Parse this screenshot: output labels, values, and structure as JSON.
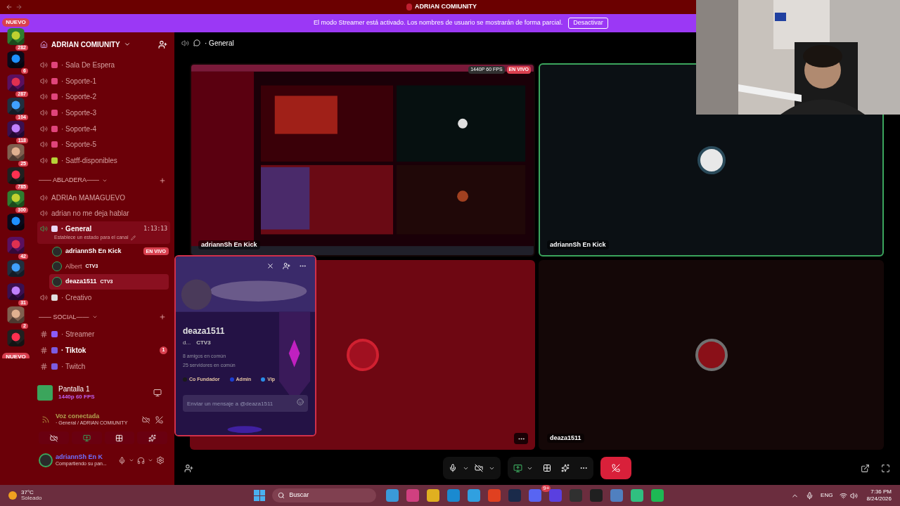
{
  "window": {
    "title": "ADRIAN COMIUNITY"
  },
  "streamer_banner": {
    "text": "El modo Streamer está activado. Los nombres de usuario se mostrarán de forma parcial.",
    "button": "Desactivar"
  },
  "rail": {
    "new_top": "NUEVO",
    "new_bottom": "NUEVO",
    "servers": [
      {
        "kind": "picture",
        "badge": "282"
      },
      {
        "kind": "picture",
        "badge": "6"
      },
      {
        "kind": "picture",
        "badge": "287"
      },
      {
        "kind": "picture",
        "badge": "104"
      },
      {
        "kind": "picture",
        "badge": "118"
      },
      {
        "kind": "picture",
        "badge": "25"
      },
      {
        "kind": "picture",
        "badge": "785"
      },
      {
        "kind": "picture",
        "badge": "300"
      },
      {
        "kind": "picture"
      },
      {
        "kind": "picture",
        "badge": "42"
      },
      {
        "kind": "picture"
      },
      {
        "kind": "picture",
        "badge": "31"
      },
      {
        "kind": "picture",
        "badge": "2"
      },
      {
        "kind": "picture"
      }
    ]
  },
  "server": {
    "name": "ADRIAN COMIUNITY"
  },
  "channels": [
    {
      "kind": "voice",
      "name": "· Sala De Espera",
      "color": "#e0457b",
      "selected": false
    },
    {
      "kind": "voice",
      "name": "· Soporte-1",
      "color": "#e0457b",
      "selected": false
    },
    {
      "kind": "voice",
      "name": "· Soporte-2",
      "color": "#e0457b",
      "selected": false
    },
    {
      "kind": "voice",
      "name": "· Soporte-3",
      "color": "#e0457b",
      "selected": false
    },
    {
      "kind": "voice",
      "name": "· Soporte-4",
      "color": "#e0457b",
      "selected": false
    },
    {
      "kind": "voice",
      "name": "· Soporte-5",
      "color": "#e0457b",
      "selected": false
    },
    {
      "kind": "voice",
      "name": "· Satff-disponibles",
      "color": "#b7d238",
      "selected": false
    },
    {
      "kind": "category",
      "name": "—— ABLADERA——"
    },
    {
      "kind": "voice",
      "name": "ADRIAn MAMAGUEVO",
      "selected": false
    },
    {
      "kind": "voice",
      "name": "adrian no me deja hablar",
      "selected": false
    },
    {
      "kind": "voice",
      "name": "· General",
      "color": "#e8d7f5",
      "selected": true,
      "timer": "1:13:13",
      "status": "Establece un estado para el canal"
    },
    {
      "kind": "user",
      "name": "adriannSh En Kick",
      "live": "EN VIVO",
      "selected": false
    },
    {
      "kind": "user",
      "name": "Albert",
      "tag": "CTV3",
      "selected": false
    },
    {
      "kind": "user",
      "name": "deaza1511",
      "tag": "CTV3",
      "selected": true
    },
    {
      "kind": "voice",
      "name": "· Creativo",
      "color": "#e0e0e0",
      "selected": false
    },
    {
      "kind": "category",
      "name": "—— SOCIAL——"
    },
    {
      "kind": "text",
      "name": "· Streamer",
      "color": "#8b5cf6",
      "unread": false
    },
    {
      "kind": "text",
      "name": "· Tiktok",
      "color": "#7c5ce0",
      "unread": true,
      "badge": "1"
    },
    {
      "kind": "text",
      "name": "· Twitch",
      "color": "#7c5ce0",
      "unread": false
    }
  ],
  "stream_panel": {
    "title": "Pantalla 1",
    "quality": "1440p 60 FPS"
  },
  "voice_panel": {
    "status": "Voz conectada",
    "location": "· General / ADRIAN COMIUNITY"
  },
  "user_panel": {
    "name": "adriannSh En K",
    "status": "Compartiendo su pan..."
  },
  "header": {
    "channel": "· General"
  },
  "tiles": [
    {
      "kind": "screen",
      "label": "adriannSh En Kick",
      "quality": "1440P 60 FPS",
      "live": "EN VIVO",
      "speaking": false
    },
    {
      "kind": "camera",
      "label": "adriannSh En Kick",
      "speaking": true
    },
    {
      "kind": "avatar",
      "speaking": false
    },
    {
      "kind": "avatar",
      "label": "deaza1511",
      "speaking": false
    }
  ],
  "profile_popup": {
    "username": "deaza1511",
    "short": "d...",
    "tag": "CTV3",
    "friends": "8 amigos en común",
    "servers": "25 servidores en común",
    "roles": [
      {
        "name": "Co Fundador",
        "color": "#1a1a1a"
      },
      {
        "name": "Admin",
        "color": "#1d3fd1"
      },
      {
        "name": "Vip",
        "color": "#2a8de8"
      }
    ],
    "placeholder": "Enviar un mensaje a @deaza1511"
  },
  "taskbar": {
    "temperature": "37°C",
    "weather": "Soleado",
    "search": "Buscar",
    "discord_badge": "9+",
    "language": "ENG",
    "time": "7:36 PM",
    "date": "8/24/2026"
  }
}
